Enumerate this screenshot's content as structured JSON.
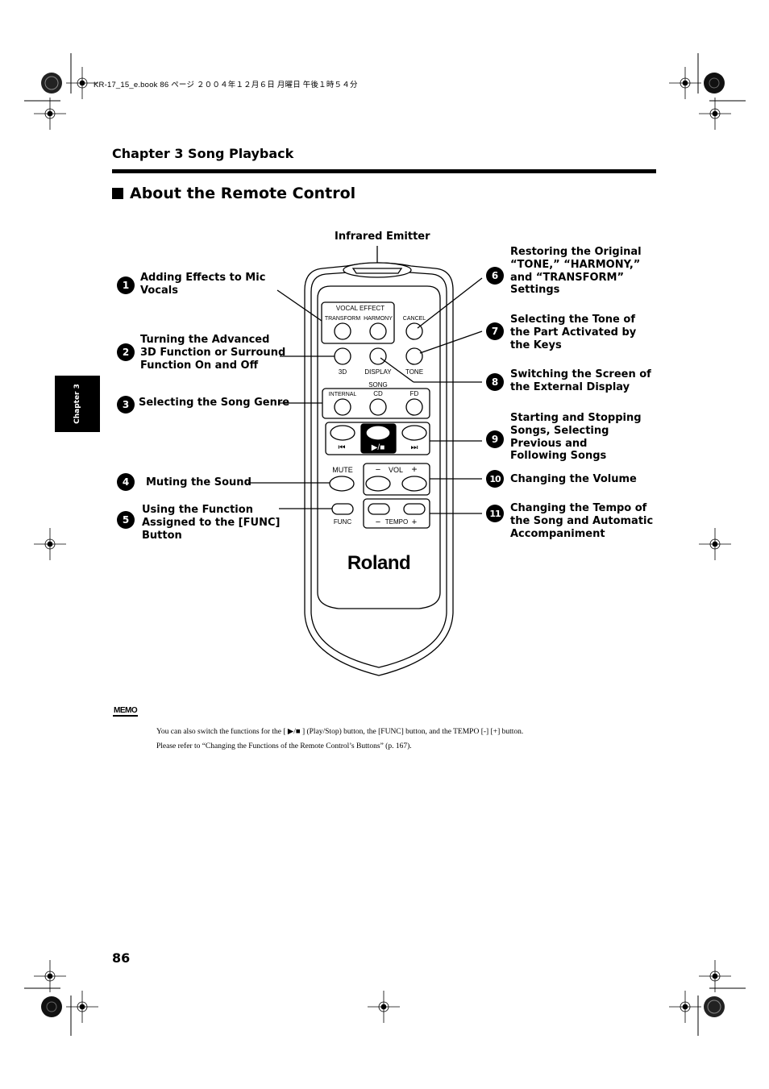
{
  "header_meta": "KR-17_15_e.book  86 ページ  ２００４年１２月６日  月曜日  午後１時５４分",
  "chapter_heading": "Chapter 3 Song Playback",
  "section_title": "About the Remote Control",
  "chapter_tab": "Chapter 3",
  "remote": {
    "emitter_label": "Infrared Emitter",
    "brand": "Roland",
    "labels": {
      "vocal_effect": "VOCAL EFFECT",
      "transform": "TRANSFORM",
      "harmony": "HARMONY",
      "cancel": "CANCEL",
      "three_d": "3D",
      "display": "DISPLAY",
      "tone": "TONE",
      "song": "SONG",
      "internal": "INTERNAL",
      "cd": "CD",
      "fd": "FD",
      "prev": "⏮",
      "play_stop": "▶/■",
      "next": "⏭",
      "mute": "MUTE",
      "vol": "VOL",
      "minus": "−",
      "plus": "+",
      "func": "FUNC",
      "tempo": "TEMPO"
    }
  },
  "callouts_left": [
    {
      "num": "1",
      "text": "Adding Effects to Mic\nVocals"
    },
    {
      "num": "2",
      "text": "Turning the Advanced\n3D Function or Surround\nFunction On and Off"
    },
    {
      "num": "3",
      "text": "Selecting the Song Genre"
    },
    {
      "num": "4",
      "text": "Muting the Sound"
    },
    {
      "num": "5",
      "text": "Using the Function\nAssigned to the [FUNC]\nButton"
    }
  ],
  "callouts_right": [
    {
      "num": "6",
      "text": "Restoring the Original\n“TONE,” “HARMONY,”\nand “TRANSFORM”\nSettings"
    },
    {
      "num": "7",
      "text": "Selecting the Tone of\nthe Part Activated by\nthe Keys"
    },
    {
      "num": "8",
      "text": "Switching the Screen of\nthe External Display"
    },
    {
      "num": "9",
      "text": "Starting and Stopping\nSongs, Selecting\nPrevious and\nFollowing Songs"
    },
    {
      "num": "10",
      "text": "Changing the Volume"
    },
    {
      "num": "11",
      "text": "Changing the Tempo of\nthe Song and Automatic\nAccompaniment"
    }
  ],
  "memo": {
    "icon_label": "MEMO",
    "line1": "You can also switch the functions for the [ ▶/■ ] (Play/Stop) button, the [FUNC] button, and the TEMPO [-] [+] button.",
    "line2": "Please refer to “Changing the Functions of the Remote Control’s Buttons” (p. 167)."
  },
  "page_number": "86"
}
